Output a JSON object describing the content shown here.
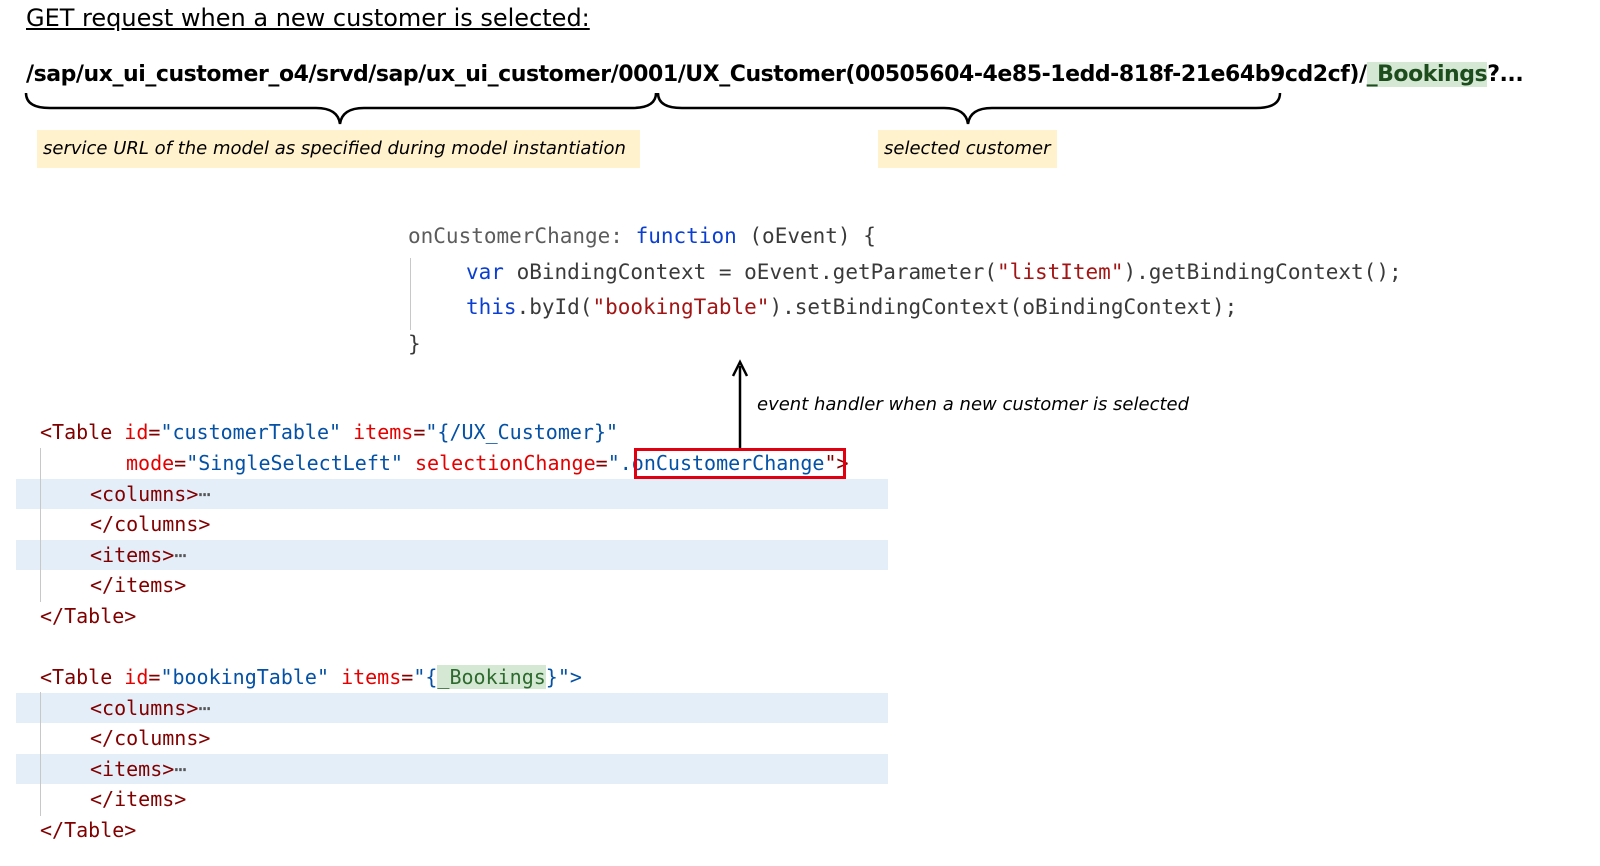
{
  "heading": "GET request when a new customer is selected:",
  "url": {
    "service_part": "/sap/ux_ui_customer_o4/srvd/sap/ux_ui_customer/0001",
    "entity_part": "/UX_Customer(00505604-4e85-1edd-818f-21e64b9cd2cf)/",
    "navigation": "_Bookings",
    "suffix": "?..."
  },
  "notes": {
    "service": "service URL of the model as specified during model instantiation",
    "customer": "selected customer"
  },
  "js_code": {
    "l1_name": "onCustomerChange:",
    "l1_kw": "function",
    "l1_rest": "(oEvent) {",
    "l2_var": "var",
    "l2_a": "oBindingContext = oEvent.getParameter(",
    "l2_str": "\"listItem\"",
    "l2_b": ").getBindingContext();",
    "l3_this": "this",
    "l3_a": ".byId(",
    "l3_str": "\"bookingTable\"",
    "l3_b": ").setBindingContext(oBindingContext);",
    "l4": "}"
  },
  "annotation": "event handler when a new customer is selected",
  "customer_table": {
    "open": "<Table",
    "id_attr": "id",
    "id_val": "\"customerTable\"",
    "items_attr": "items",
    "items_val": "\"{/UX_Customer}\"",
    "mode_attr": "mode",
    "mode_val": "\"SingleSelectLeft\"",
    "sel_attr": "selectionChange",
    "sel_val_q": "\"",
    "sel_val": ".onCustomerChange",
    "sel_close": "\">",
    "columns_open": "<columns>",
    "columns_close": "</columns>",
    "items_open": "<items>",
    "items_close": "</items>",
    "close": "</Table>",
    "ellipsis": "⋯"
  },
  "booking_table": {
    "open": "<Table",
    "id_attr": "id",
    "id_val": "\"bookingTable\"",
    "items_attr": "items",
    "items_val_open": "\"{",
    "items_binding": "_Bookings",
    "items_val_close": "}\">",
    "columns_open": "<columns>",
    "columns_close": "</columns>",
    "items_open": "<items>",
    "items_close": "</items>",
    "close": "</Table>",
    "ellipsis": "⋯"
  },
  "colors": {
    "note_bg": "#fff2cc",
    "green_highlight": "#d5e8d4",
    "row_highlight": "#e4eef9",
    "red_box": "#e0000f",
    "keyword_blue": "#0b3fd1",
    "string_red": "#a31515"
  }
}
